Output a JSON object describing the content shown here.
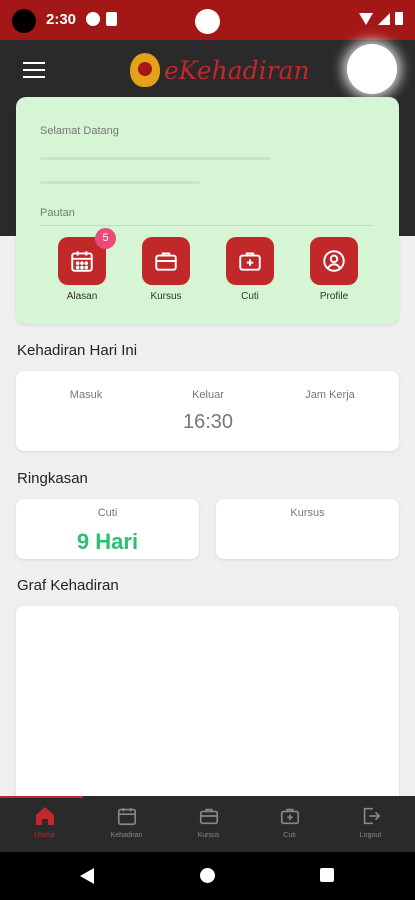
{
  "status_bar": {
    "time": "2:30"
  },
  "app": {
    "title": "eKehadiran"
  },
  "welcome": {
    "greeting": "Selamat Datang",
    "links_label": "Pautan",
    "shortcuts": [
      {
        "label": "Alasan",
        "icon": "calendar-icon",
        "badge": "5"
      },
      {
        "label": "Kursus",
        "icon": "briefcase-icon"
      },
      {
        "label": "Cuti",
        "icon": "medical-kit-icon"
      },
      {
        "label": "Profile",
        "icon": "user-circle-icon"
      }
    ]
  },
  "attendance": {
    "title": "Kehadiran Hari Ini",
    "in_label": "Masuk",
    "out_label": "Keluar",
    "hours_label": "Jam Kerja",
    "out_value": "16:30"
  },
  "summary": {
    "title": "Ringkasan",
    "leave_label": "Cuti",
    "leave_value": "9 Hari",
    "course_label": "Kursus"
  },
  "graph": {
    "title": "Graf Kehadiran"
  },
  "bottom_nav": {
    "items": [
      {
        "label": "Utama",
        "icon": "home-icon"
      },
      {
        "label": "Kehadiran",
        "icon": "calendar-icon"
      },
      {
        "label": "Kursus",
        "icon": "briefcase-icon"
      },
      {
        "label": "Cuti",
        "icon": "medical-kit-icon"
      },
      {
        "label": "Logout",
        "icon": "logout-icon"
      }
    ]
  },
  "colors": {
    "brand": "#c0282a",
    "status_bar": "#a31717",
    "success": "#2fbf71",
    "welcome_bg": "#d5f5d5"
  }
}
